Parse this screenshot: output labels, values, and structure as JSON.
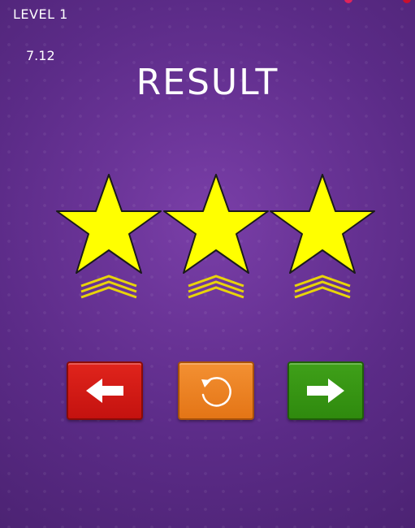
{
  "hud": {
    "level_label": "LEVEL 1",
    "timer": "7.12"
  },
  "result": {
    "title": "RESULT",
    "stars_earned": 3,
    "stars_total": 3
  },
  "buttons": {
    "prev": {
      "icon": "arrow-left-icon"
    },
    "retry": {
      "icon": "restart-icon"
    },
    "next": {
      "icon": "arrow-right-icon"
    }
  },
  "colors": {
    "background": "#5b2b87",
    "star_fill": "#ffff00",
    "star_outline": "#1a1a1a",
    "prev_button": "#d21a15",
    "retry_button": "#ec8124",
    "next_button": "#369414"
  }
}
